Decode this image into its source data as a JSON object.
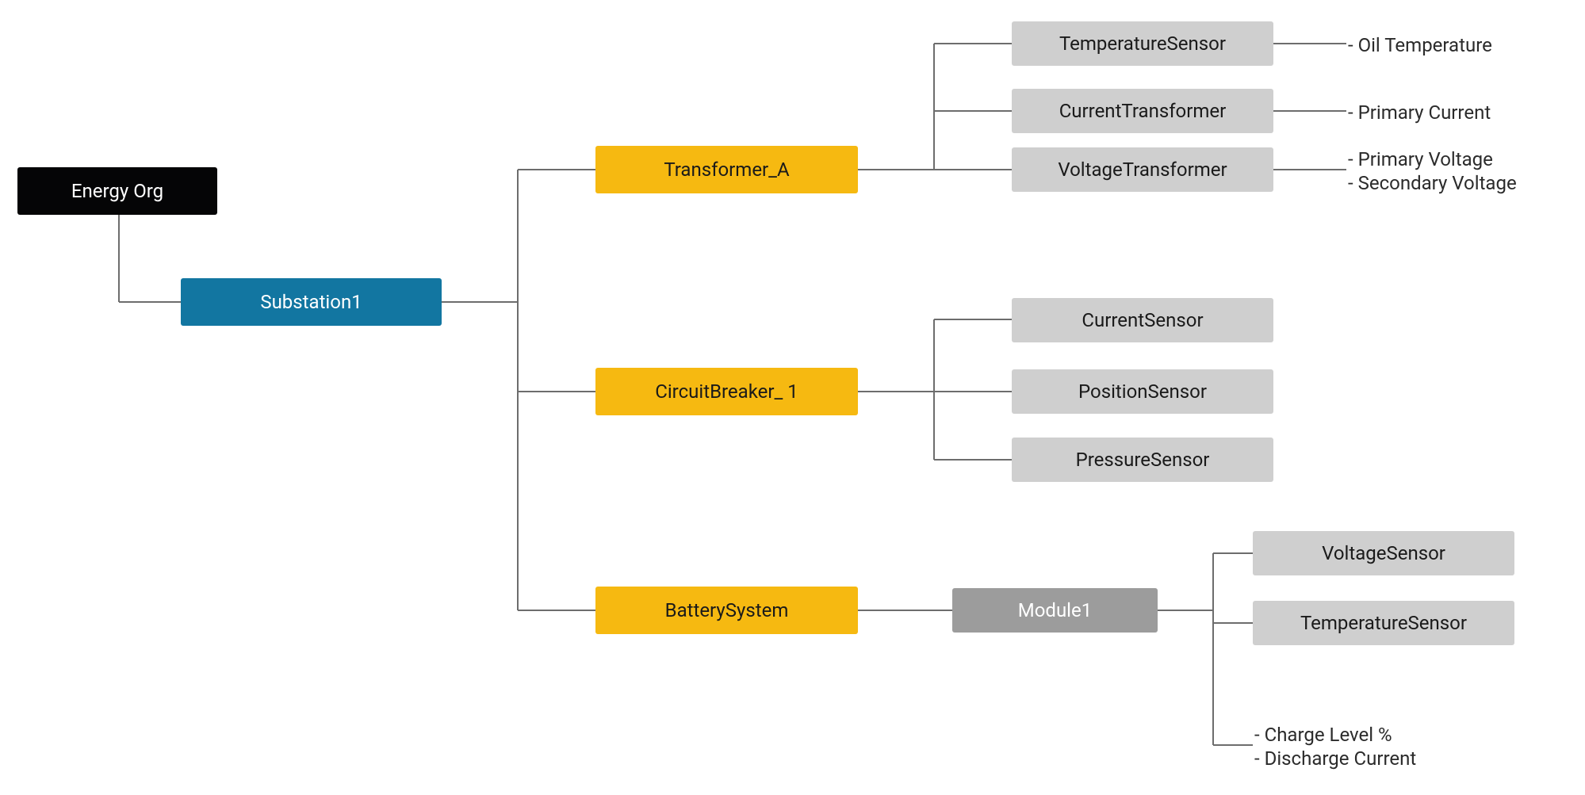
{
  "chart_data": {
    "type": "tree",
    "root": {
      "label": "Energy Org",
      "children": [
        {
          "label": "Substation1",
          "children": [
            {
              "label": "Transformer_A",
              "children": [
                {
                  "label": "TemperatureSensor",
                  "attributes": [
                    "Oil Temperature"
                  ]
                },
                {
                  "label": "CurrentTransformer",
                  "attributes": [
                    "Primary Current"
                  ]
                },
                {
                  "label": "VoltageTransformer",
                  "attributes": [
                    "Primary Voltage",
                    "Secondary Voltage"
                  ]
                }
              ]
            },
            {
              "label": "CircuitBreaker_ 1",
              "children": [
                {
                  "label": "CurrentSensor"
                },
                {
                  "label": "PositionSensor"
                },
                {
                  "label": "PressureSensor"
                }
              ]
            },
            {
              "label": "BatterySystem",
              "children": [
                {
                  "label": "Module1",
                  "attributes": [
                    "Charge Level %",
                    "Discharge Current"
                  ],
                  "children": [
                    {
                      "label": "VoltageSensor"
                    },
                    {
                      "label": "TemperatureSensor"
                    }
                  ]
                }
              ]
            }
          ]
        }
      ]
    }
  },
  "nodes": {
    "root": "Energy Org",
    "substation": "Substation1",
    "transformer": "Transformer_A",
    "breaker": "CircuitBreaker_ 1",
    "battery": "BatterySystem",
    "module1": "Module1",
    "t_temp": "TemperatureSensor",
    "t_ct": "CurrentTransformer",
    "t_vt": "VoltageTransformer",
    "cb_cs": "CurrentSensor",
    "cb_ps": "PositionSensor",
    "cb_pr": "PressureSensor",
    "m_vs": "VoltageSensor",
    "m_ts": "TemperatureSensor"
  },
  "attrs": {
    "oil": "- Oil Temperature",
    "pcur": "- Primary Current",
    "pvolt": "- Primary Voltage",
    "svolt": "- Secondary Voltage",
    "charge": "- Charge Level %",
    "discharge": "- Discharge Current"
  },
  "colors": {
    "black": "#050506",
    "teal": "#1276a1",
    "amber": "#f6b911",
    "gray": "#cfcfcf",
    "darkgray": "#9c9c9c",
    "line": "#6d6d6d"
  }
}
